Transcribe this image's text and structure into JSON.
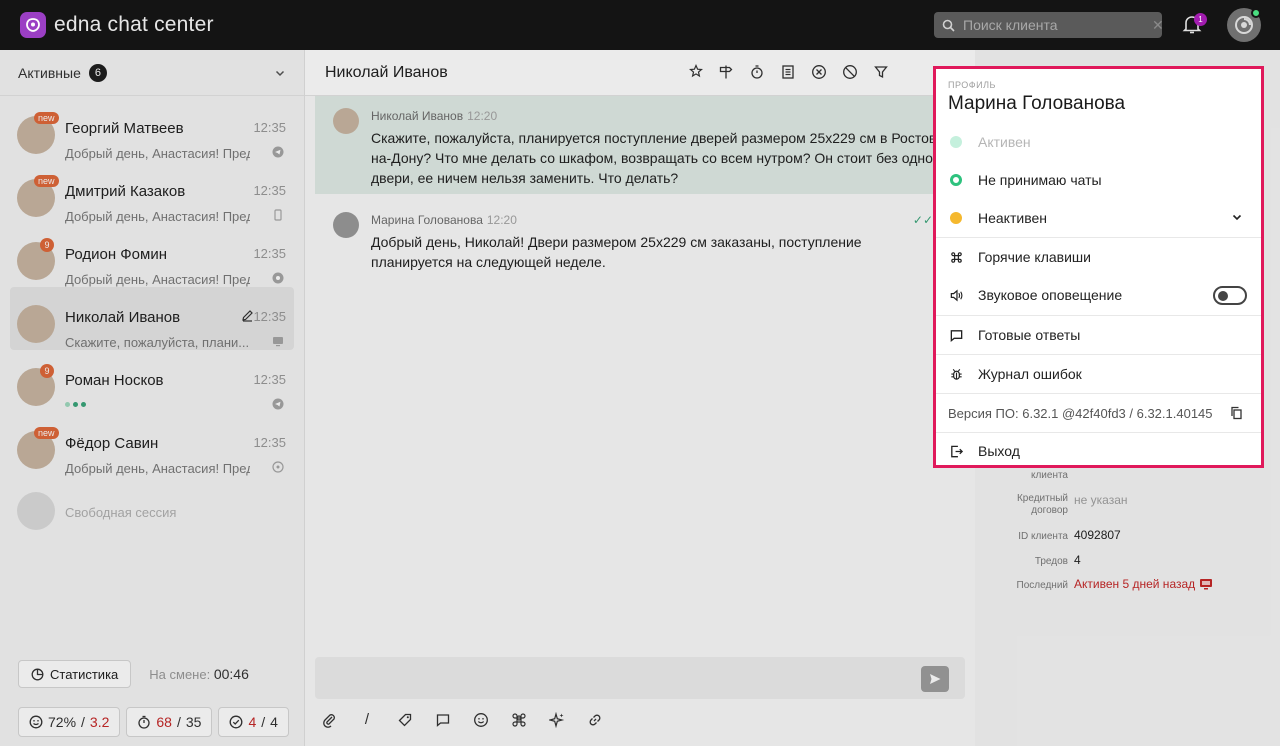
{
  "app": {
    "brand": "edna chat center",
    "accent": "#9b3fc4"
  },
  "topbar": {
    "search_placeholder": "Поиск клиента",
    "notifications_count": "1"
  },
  "sidebar": {
    "filter_label": "Активные",
    "count": "6",
    "chats": [
      {
        "name": "Георгий Матвеев",
        "time": "12:35",
        "preview": "Добрый день, Анастасия! Пред...",
        "badge": "new"
      },
      {
        "name": "Дмитрий Казаков",
        "time": "12:35",
        "preview": "Добрый день, Анастасия! Пред...",
        "badge": "new"
      },
      {
        "name": "Родион Фомин",
        "time": "12:35",
        "preview": "Добрый день, Анастасия! Пред...",
        "badge": "9"
      },
      {
        "name": "Николай Иванов",
        "time": "12:35",
        "preview": "Скажите, пожалуйста, плани...",
        "badge": ""
      },
      {
        "name": "Роман Носков",
        "time": "12:35",
        "preview": "",
        "badge": "9"
      },
      {
        "name": "Фёдор Савин",
        "time": "12:35",
        "preview": "Добрый день, Анастасия! Пред...",
        "badge": "new"
      }
    ],
    "free_session": "Свободная сессия",
    "stats_button": "Статистика",
    "shift_label": "На смене:",
    "shift_time": "00:46",
    "metrics": [
      {
        "a": "72%",
        "b": "3.2"
      },
      {
        "a": "68",
        "b": "35"
      },
      {
        "a": "4",
        "b": "4"
      }
    ]
  },
  "chat": {
    "title": "Николай Иванов",
    "messages": [
      {
        "author": "Николай Иванов",
        "time": "12:20",
        "text": "Скажите, пожалуйста, планируется поступление дверей размером 25х229 см в Ростов-на-Дону? Что мне делать со шкафом, возвращать со всем нутром? Он стоит без одной двери, ее ничем нельзя заменить. Что делать?"
      },
      {
        "author": "Марина Голованова",
        "time": "12:20",
        "text": "Добрый день, Николай! Двери размером 25х229 см заказаны, поступление планируется на следующей неделе."
      }
    ]
  },
  "info": {
    "rows": [
      {
        "label_1": "клиента",
        "label_2": "",
        "value": ""
      },
      {
        "label_1": "Кредитный",
        "label_2": "договор",
        "value": "не указан"
      },
      {
        "label_1": "ID клиента",
        "label_2": "",
        "value": "4092807"
      },
      {
        "label_1": "Тредов",
        "label_2": "",
        "value": "4"
      },
      {
        "label_1": "Последний",
        "label_2": "",
        "value": "Активен 5 дней назад"
      }
    ]
  },
  "profile": {
    "caption": "ПРОФИЛЬ",
    "name": "Марина Голованова",
    "statuses": [
      {
        "label": "Активен",
        "color": "#b9efd8"
      },
      {
        "label": "Не принимаю чаты",
        "color": "#2ec27e"
      },
      {
        "label": "Неактивен",
        "color": "#f5b82e"
      }
    ],
    "hotkeys": "Горячие клавиши",
    "sound": "Звуковое оповещение",
    "templates": "Готовые ответы",
    "error_log": "Журнал ошибок",
    "version": "Версия ПО: 6.32.1 @42f40fd3 / 6.32.1.40145",
    "logout": "Выход",
    "highlight": "#e0195b"
  }
}
